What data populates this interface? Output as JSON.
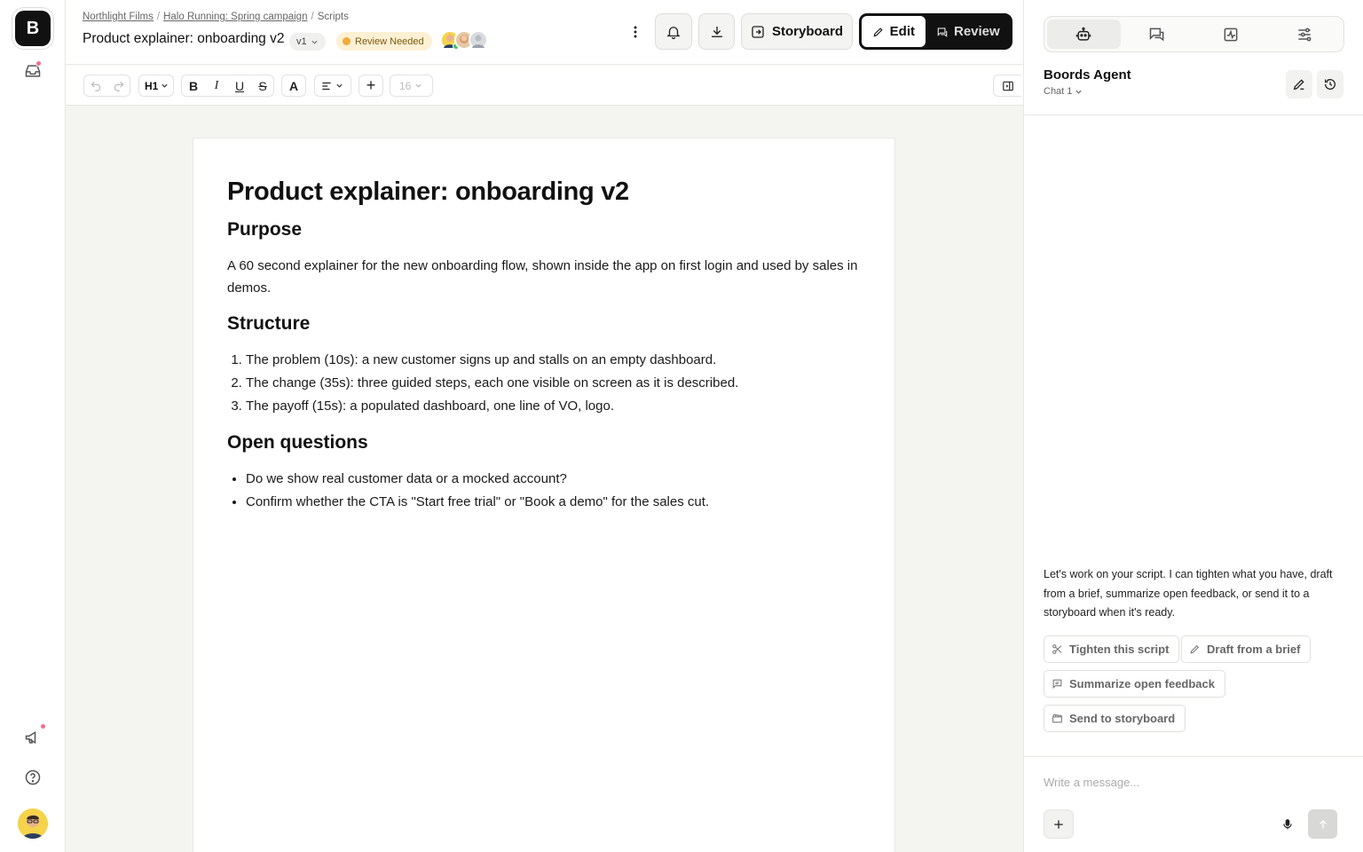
{
  "app": {
    "logo_letter": "B",
    "brand_color": "#111111",
    "accent_dot_color": "#f06f8a"
  },
  "rail": {
    "icons": [
      "inbox-icon",
      "megaphone-icon",
      "help-icon",
      "user-avatar"
    ]
  },
  "header": {
    "breadcrumbs": [
      "Northlight Films",
      "Halo Running: Spring campaign",
      "Scripts"
    ],
    "title": "Product explainer: onboarding v2",
    "version": "v1",
    "status_badge": "Review Needed",
    "storyboard_label": "Storyboard",
    "edit_label": "Edit",
    "review_label": "Review",
    "active_mode": "Edit"
  },
  "toolbar": {
    "heading_label": "H1",
    "bold": "B",
    "italic": "I",
    "underline": "U",
    "strike": "S",
    "text_color": "A",
    "insert": "+",
    "font_size": "16"
  },
  "document": {
    "title": "Product explainer: onboarding v2",
    "purpose_heading": "Purpose",
    "purpose_text": "A 60 second explainer for the new onboarding flow, shown inside the app on first login and used by sales in demos.",
    "structure_heading": "Structure",
    "structure_items": [
      "The problem (10s): a new customer signs up and stalls on an empty dashboard.",
      "The change (35s): three guided steps, each one visible on screen as it is described.",
      "The payoff (15s): a populated dashboard, one line of VO, logo."
    ],
    "questions_heading": "Open questions",
    "question_items": [
      "Do we show real customer data or a mocked account?",
      "Confirm whether the CTA is \"Start free trial\" or \"Book a demo\" for the sales cut."
    ]
  },
  "side_panel": {
    "tabs": [
      "agent-tab",
      "comments-tab",
      "activity-tab",
      "settings-tab"
    ],
    "agent_title": "Boords Agent",
    "chat_label": "Chat 1",
    "agent_message": "Let's work on your script. I can tighten what you have, draft from a brief, summarize open feedback, or send it to a storyboard when it's ready.",
    "suggestions": [
      "Tighten this script",
      "Draft from a brief",
      "Summarize open feedback",
      "Send to storyboard"
    ],
    "composer_placeholder": "Write a message..."
  }
}
